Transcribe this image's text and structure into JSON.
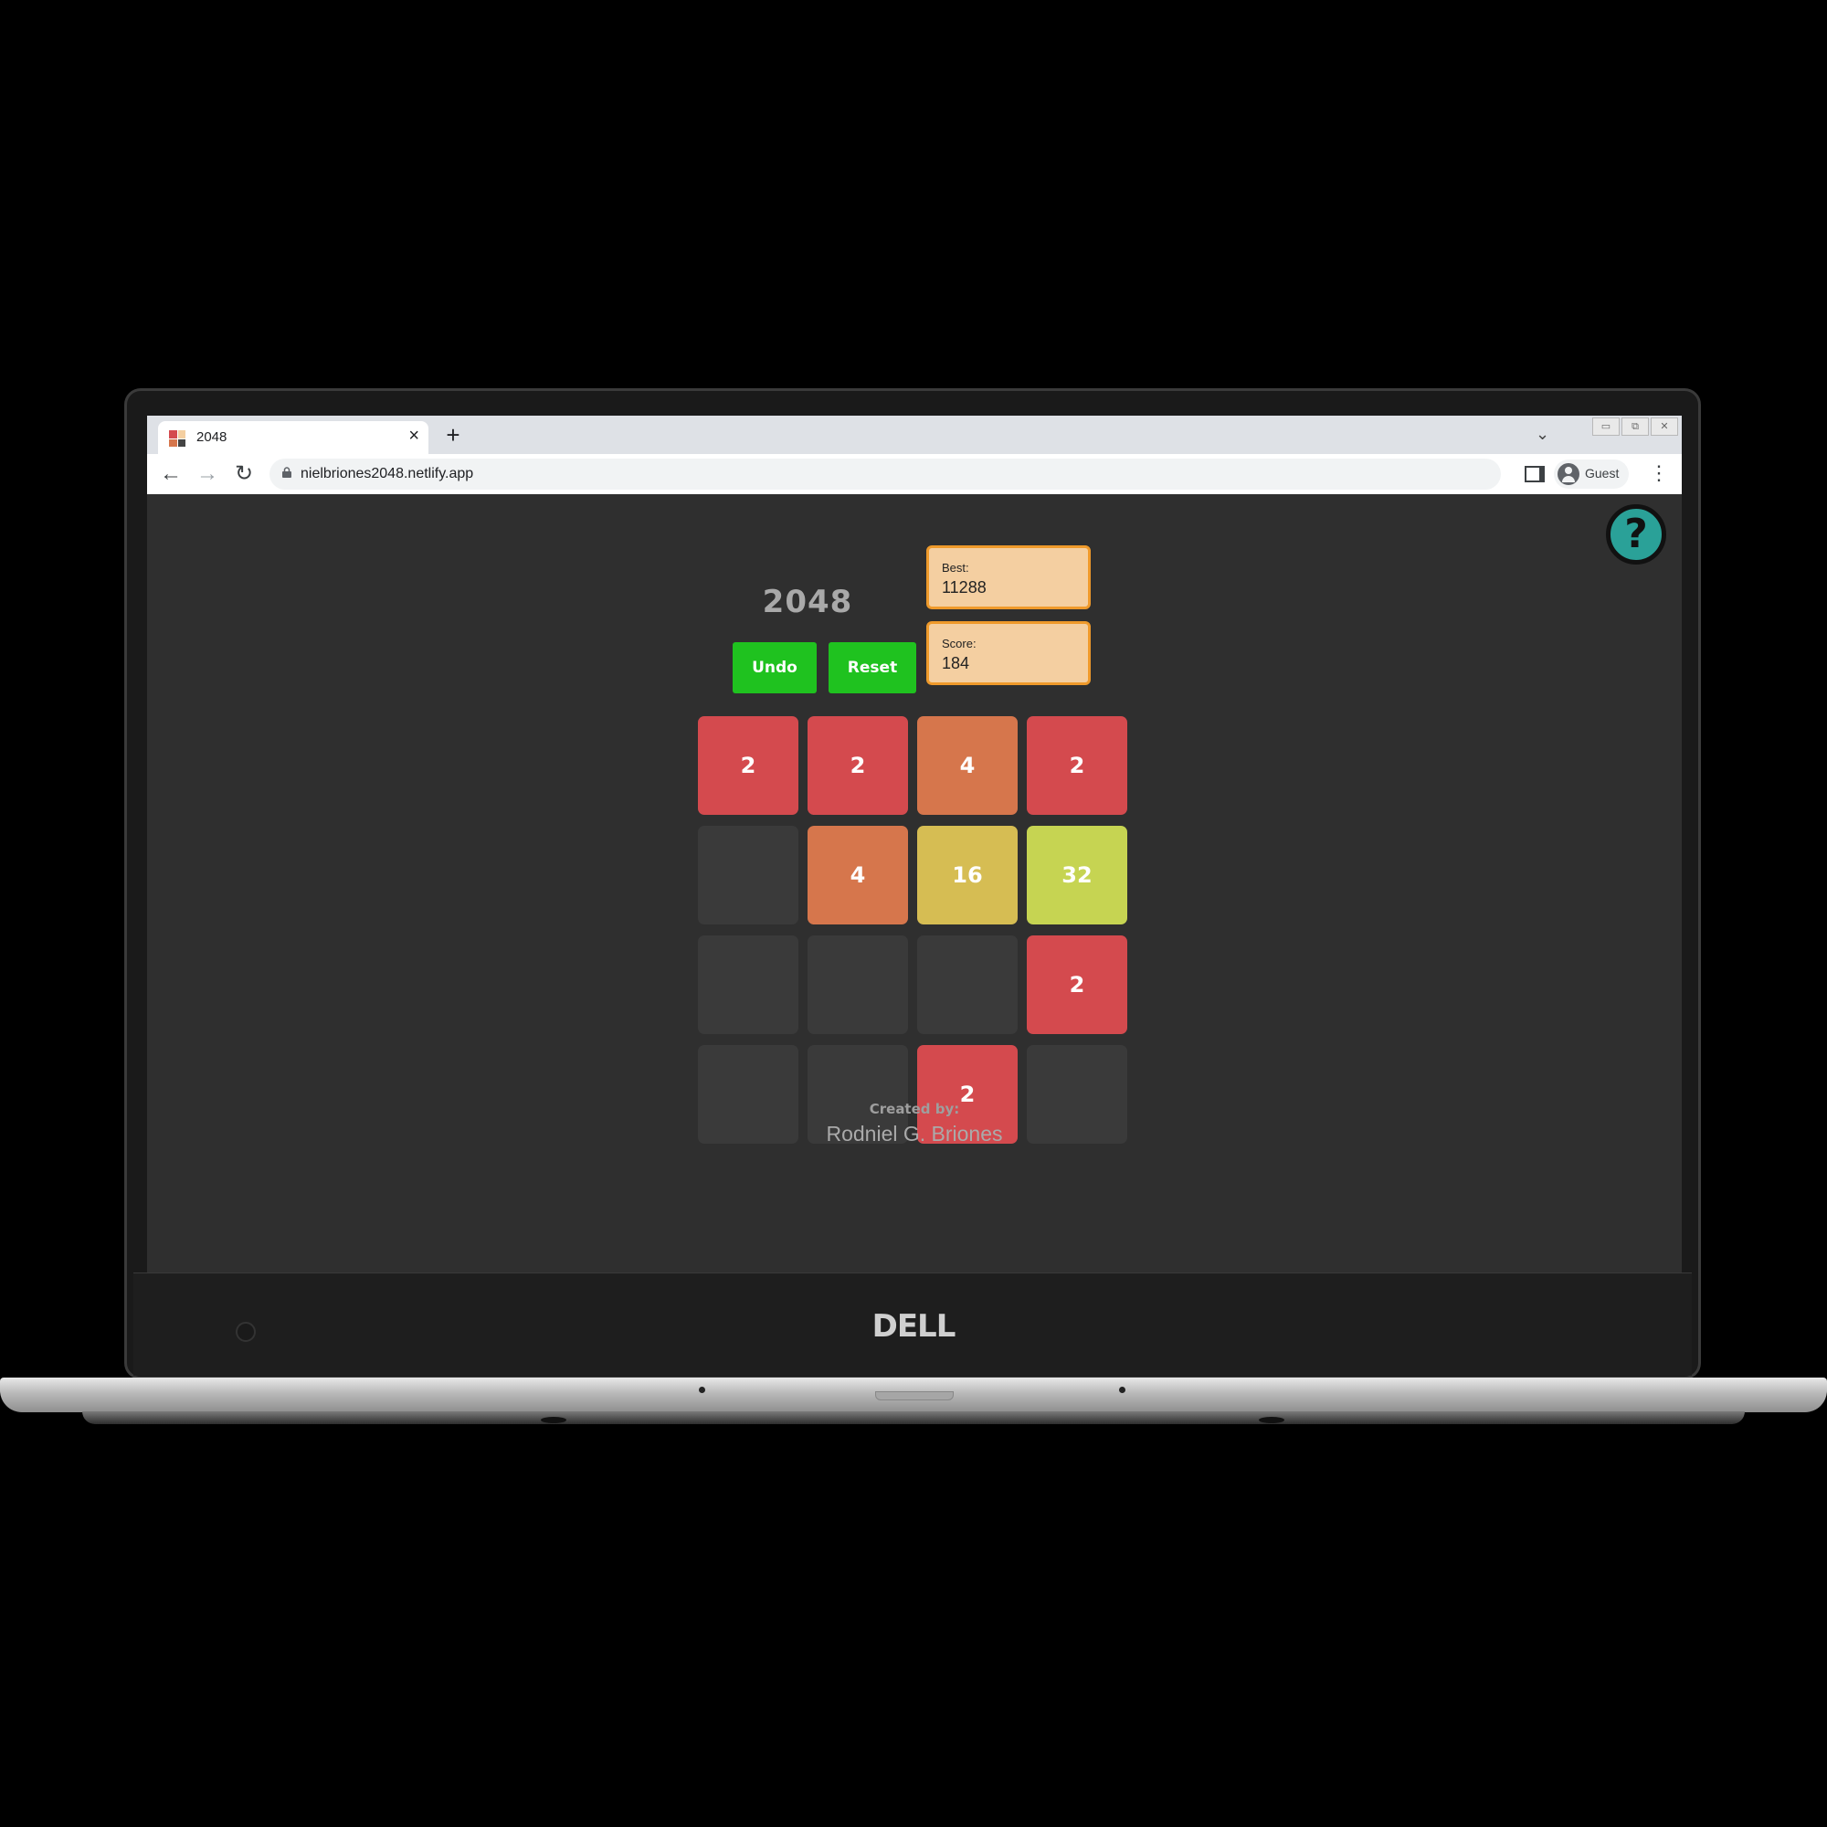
{
  "browser": {
    "tab_title": "2048",
    "new_tab": "+",
    "tab_close": "×",
    "url": "nielbriones2048.netlify.app",
    "profile": "Guest",
    "win_buttons": [
      "▭",
      "⧉",
      "✕"
    ]
  },
  "game": {
    "title": "2048",
    "help_label": "?",
    "buttons": {
      "undo": "Undo",
      "reset": "Reset"
    },
    "best": {
      "label": "Best:",
      "value": "11288"
    },
    "score": {
      "label": "Score:",
      "value": "184"
    },
    "board": [
      [
        2,
        2,
        4,
        2
      ],
      [
        null,
        4,
        16,
        32
      ],
      [
        null,
        null,
        null,
        2
      ],
      [
        null,
        null,
        2,
        null
      ]
    ],
    "tile_colors": {
      "2": "#d44a4e",
      "4": "#d6764c",
      "16": "#d6bd53",
      "32": "#c6d452",
      "empty": "#3a3a3a"
    },
    "credit_label": "Created by:",
    "credit_name": "Rodniel G. Briones"
  },
  "device": {
    "brand": "DELL"
  },
  "colors": {
    "button_green": "#1fc21f",
    "score_bg": "#f4cfa1",
    "score_border": "#ef9a2b",
    "page_bg": "#2f2f2f",
    "help_bg": "#2aa198"
  }
}
